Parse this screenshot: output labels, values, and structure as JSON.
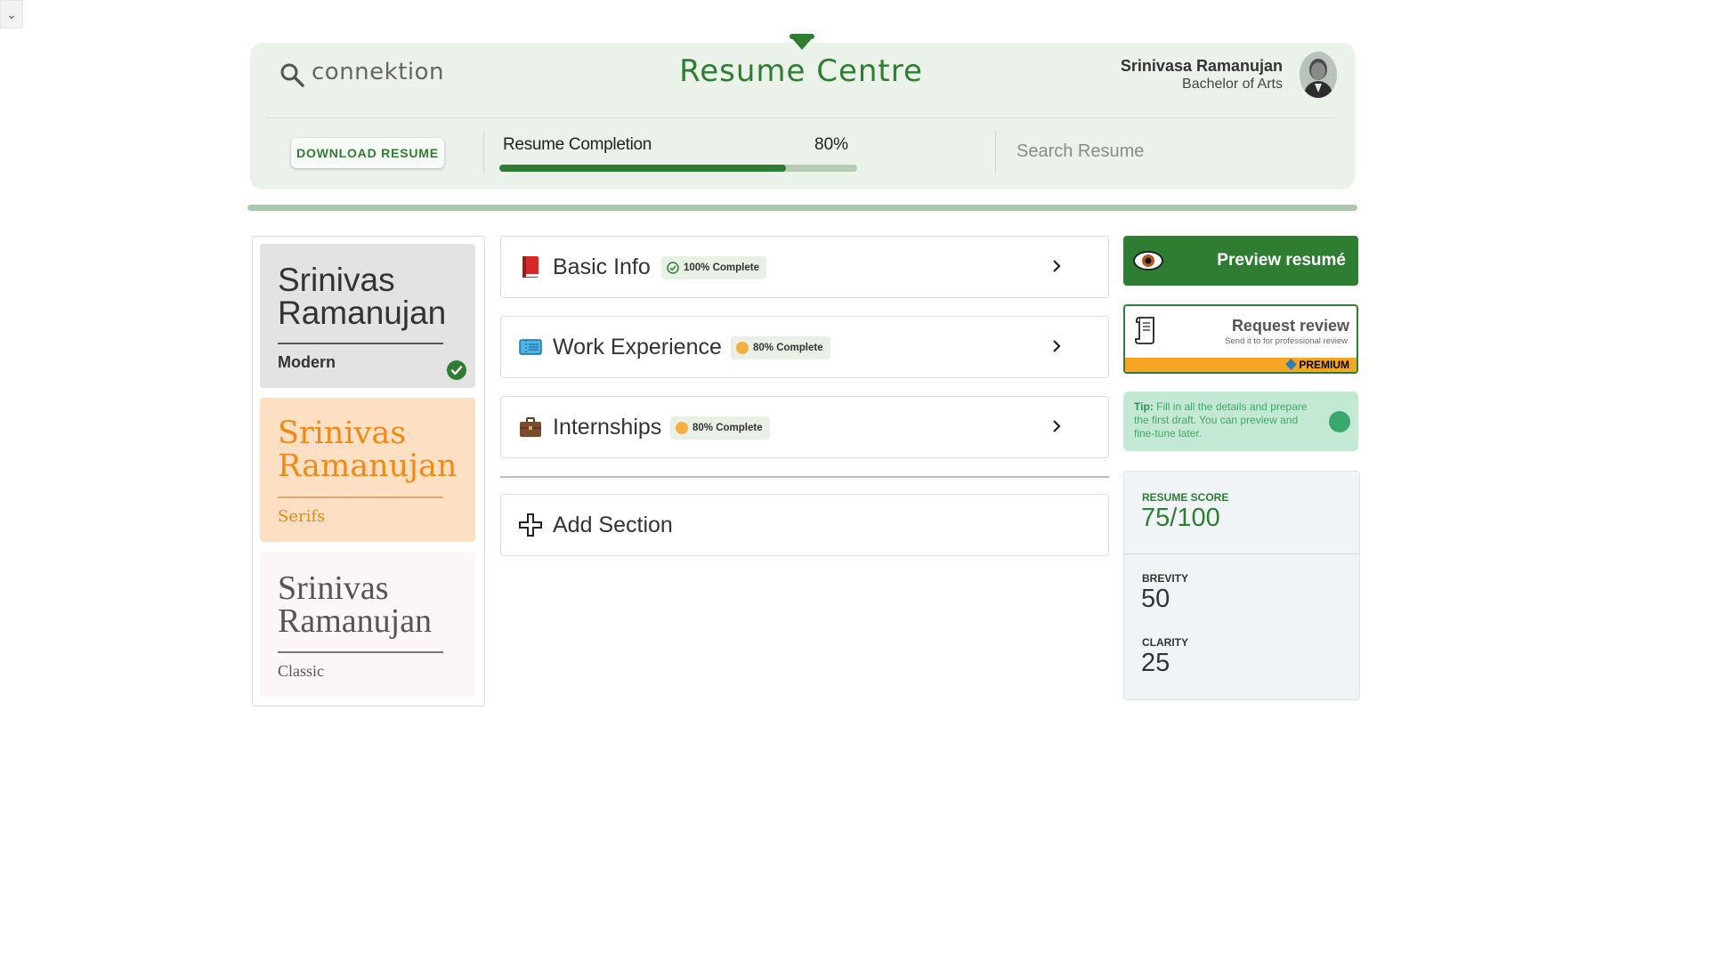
{
  "corner": {
    "icon": "chevron-down-icon",
    "glyph": "⌄"
  },
  "header": {
    "brand": "connektion",
    "title": "Resume Centre",
    "user_name": "Srinivasa Ramanujan",
    "user_degree": "Bachelor of Arts",
    "download_label": "DOWNLOAD RESUME",
    "completion_label": "Resume Completion",
    "completion_pct": "80%",
    "completion_value": 0.8,
    "search_placeholder": "Search Resume"
  },
  "templates": [
    {
      "name": "Srinivas Ramanujan",
      "style": "Modern",
      "selected": true
    },
    {
      "name": "Srinivas Ramanujan",
      "style": "Serifs",
      "selected": false
    },
    {
      "name": "Srinivas Ramanujan",
      "style": "Classic",
      "selected": false
    }
  ],
  "sections": [
    {
      "title": "Basic Info",
      "status": "100% Complete",
      "icon": "book-icon"
    },
    {
      "title": "Work Experience",
      "status": "80% Complete",
      "icon": "ticket-icon"
    },
    {
      "title": "Internships",
      "status": "80% Complete",
      "icon": "briefcase-icon"
    }
  ],
  "add_section": "Add Section",
  "preview_label": "Preview resumé",
  "review": {
    "title": "Request review",
    "subtitle": "Send it to for professional review",
    "premium": "PREMIUM"
  },
  "tip": {
    "prefix": "Tip:",
    "text": "Fill in all the details and prepare the first draft. You can preview and fine-tune later."
  },
  "scores": {
    "score_label": "RESUME SCORE",
    "score_value": "75/100",
    "brevity_label": "BREVITY",
    "brevity_value": "50",
    "clarity_label": "CLARITY",
    "clarity_value": "25"
  },
  "colors": {
    "accent": "#2e7d32",
    "serif_accent": "#f28a12",
    "premium": "#f5a623",
    "tip_bg": "#c3e8d3"
  }
}
